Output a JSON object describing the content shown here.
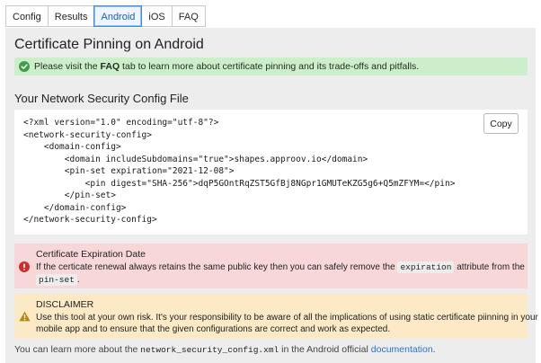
{
  "tabs": [
    {
      "label": "Config",
      "active": false
    },
    {
      "label": "Results",
      "active": false
    },
    {
      "label": "Android",
      "active": true
    },
    {
      "label": "iOS",
      "active": false
    },
    {
      "label": "FAQ",
      "active": false
    }
  ],
  "page": {
    "title": "Certificate Pinning on Android"
  },
  "info": {
    "prefix": "Please visit the ",
    "faq": "FAQ",
    "suffix": " tab to learn more about certificate pinning and its trade-offs and pitfalls.",
    "icon": "check-circle-icon",
    "color": "#cdeecb"
  },
  "config_file": {
    "title": "Your Network Security Config File",
    "copy_label": "Copy",
    "lines": [
      "<?xml version=\"1.0\" encoding=\"utf-8\"?>",
      "<network-security-config>",
      "    <domain-config>",
      "        <domain includeSubdomains=\"true\">shapes.approov.io</domain>",
      "        <pin-set expiration=\"2021-12-08\">",
      "            <pin digest=\"SHA-256\">dqP5GOntRqZST5GfBj8NGpr1GMUTeKZG5g6+Q5mZFYM=</pin>",
      "        </pin-set>",
      "    </domain-config>",
      "</network-security-config>"
    ]
  },
  "expiration": {
    "title": "Certificate Expiration Date",
    "text1": "If the certicate renewal always retains the same public key then you can safely remove the ",
    "code1": "expiration",
    "text2": " attribute from the",
    "code2": "pin-set",
    "text3": ".",
    "icon": "alert-circle-icon",
    "color": "#f8d7d8"
  },
  "disclaimer": {
    "title": "DISCLAIMER",
    "line1": "Use this tool at your own risk. It's your responsibility to be aware of all the implications of using static certificate piinning in your",
    "line2": "mobile app and to ensure that the given configurations are correct and work as expected.",
    "icon": "warning-triangle-icon",
    "color": "#fbeac5"
  },
  "footer": {
    "prefix": "You can learn more about the ",
    "code": "network_security_config.xml",
    "middle": " in the Android official ",
    "link": "documentation",
    "suffix": "."
  }
}
